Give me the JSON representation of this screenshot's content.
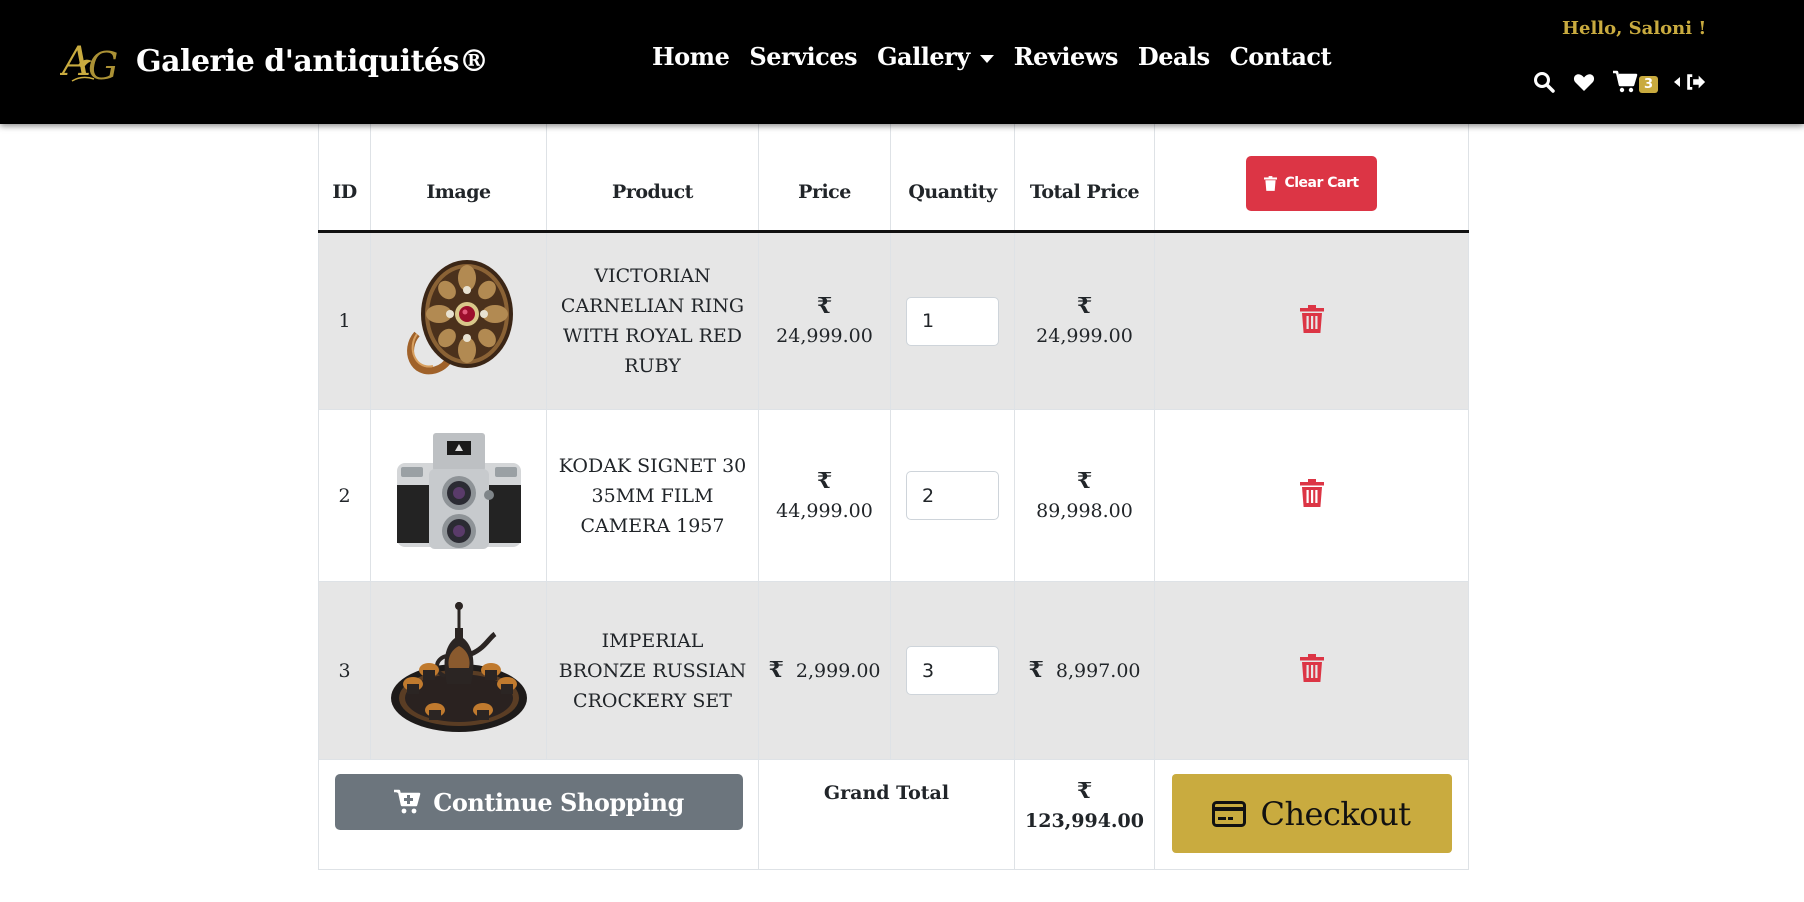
{
  "brand": {
    "name": "Galerie d'antiquités®",
    "logo_text": "AG",
    "gold": "#c9ab3f"
  },
  "nav": {
    "links": [
      {
        "label": "Home"
      },
      {
        "label": "Services"
      },
      {
        "label": "Gallery"
      },
      {
        "label": "Reviews"
      },
      {
        "label": "Deals"
      },
      {
        "label": "Contact"
      }
    ],
    "greeting": "Hello, Saloni !",
    "icons": [
      "search-icon",
      "heart-icon",
      "cart-icon",
      "logout-icon"
    ],
    "cart_count": "3"
  },
  "table": {
    "headers": [
      "ID",
      "Image",
      "Product",
      "Price",
      "Quantity",
      "Total Price"
    ],
    "clear_cart_label": "Clear Cart",
    "currency": "₹",
    "rows": [
      {
        "id": "1",
        "image": "ring-image",
        "product": "VICTORIAN CARNELIAN RING WITH ROYAL RED RUBY",
        "price": "24,999.00",
        "quantity": "1",
        "total": "24,999.00"
      },
      {
        "id": "2",
        "image": "camera-image",
        "product": "KODAK SIGNET 30 35MM FILM CAMERA 1957",
        "price": "44,999.00",
        "quantity": "2",
        "total": "89,998.00"
      },
      {
        "id": "3",
        "image": "crockery-image",
        "product": "IMPERIAL BRONZE RUSSIAN CROCKERY SET",
        "price": "2,999.00",
        "quantity": "3",
        "total": "8,997.00"
      }
    ],
    "footer": {
      "continue_label": "Continue Shopping",
      "grand_total_label": "Grand Total",
      "grand_total": "123,994.00",
      "checkout_label": "Checkout"
    }
  },
  "colors": {
    "danger": "#dc3545",
    "secondary": "#6c757d",
    "gold": "#c9ab3f",
    "navbar": "#000000",
    "stripe": "#e6e6e6"
  }
}
